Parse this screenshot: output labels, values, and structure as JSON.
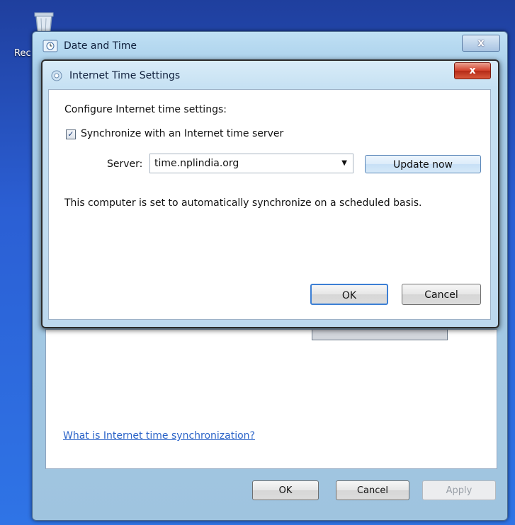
{
  "desktop": {
    "icon_label": "Rec"
  },
  "outer_window": {
    "title": "Date and Time",
    "close_label": "x",
    "help_link": "What is Internet time synchronization?",
    "ok_label": "OK",
    "cancel_label": "Cancel",
    "apply_label": "Apply"
  },
  "dialog": {
    "title": "Internet Time Settings",
    "close_label": "x",
    "heading": "Configure Internet time settings:",
    "sync_checkbox_label": "Synchronize with an Internet time server",
    "sync_checked": true,
    "check_mark": "✓",
    "server_label": "Server:",
    "server_value": "time.nplindia.org",
    "dropdown_arrow": "▼",
    "update_button": "Update now",
    "status_text": "This computer is set to automatically synchronize on a scheduled basis.",
    "ok_label": "OK",
    "cancel_label": "Cancel"
  },
  "colors": {
    "accent": "#2a63c8",
    "close_red": "#d2402a"
  }
}
